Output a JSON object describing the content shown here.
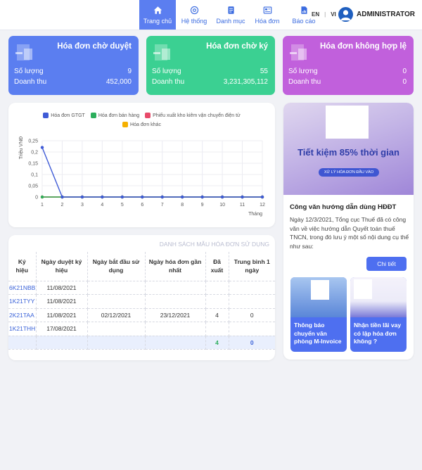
{
  "header": {
    "nav": [
      {
        "label": "Trang chủ",
        "icon": "home-icon",
        "active": true
      },
      {
        "label": "Hệ thống",
        "icon": "settings-icon"
      },
      {
        "label": "Danh mục",
        "icon": "list-icon"
      },
      {
        "label": "Hóa đơn",
        "icon": "invoice-icon"
      },
      {
        "label": "Báo cáo",
        "icon": "report-icon"
      }
    ],
    "lang_en": "EN",
    "lang_sep": "|",
    "lang_vi": "VI",
    "user": "ADMINISTRATOR"
  },
  "stats": [
    {
      "title": "Hóa đơn chờ duyệt",
      "count_label": "Số lượng",
      "count": "9",
      "revenue_label": "Doanh thu",
      "revenue": "452,000",
      "color": "#5b7ef0"
    },
    {
      "title": "Hóa đơn chờ ký",
      "count_label": "Số lượng",
      "count": "55",
      "revenue_label": "Doanh thu",
      "revenue": "3,231,305,112",
      "color": "#3bd092"
    },
    {
      "title": "Hóa đơn không hợp lệ",
      "count_label": "Số lượng",
      "count": "0",
      "revenue_label": "Doanh thu",
      "revenue": "0",
      "color": "#c160dc"
    }
  ],
  "chart_data": {
    "type": "line",
    "x": [
      1,
      2,
      3,
      4,
      5,
      6,
      7,
      8,
      9,
      10,
      11,
      12
    ],
    "xlabel": "Tháng",
    "ylabel": "Triệu VNĐ",
    "ylim": [
      0,
      0.25
    ],
    "yticks": [
      "0",
      "0,05",
      "0,1",
      "0,15",
      "0,2",
      "0,25"
    ],
    "grid": true,
    "legend_position": "top",
    "series": [
      {
        "name": "Hóa đơn GTGT",
        "color": "#3f5bd6",
        "values": [
          0.22,
          0,
          0,
          0,
          0,
          0,
          0,
          0,
          0,
          0,
          0,
          0
        ]
      },
      {
        "name": "Hóa đơn bán hàng",
        "color": "#2cae5c",
        "values": [
          0,
          0,
          0,
          0,
          0,
          0,
          0,
          0,
          0,
          0,
          0,
          0
        ]
      },
      {
        "name": "Phiếu xuất kho kiêm vận chuyển điện tử",
        "color": "#e84a6a",
        "values": [
          0,
          0,
          0,
          0,
          0,
          0,
          0,
          0,
          0,
          0,
          0,
          0
        ]
      },
      {
        "name": "Hóa đơn khác",
        "color": "#f5b000",
        "values": [
          0,
          0,
          0,
          0,
          0,
          0,
          0,
          0,
          0,
          0,
          0,
          0
        ]
      }
    ]
  },
  "table": {
    "title": "DANH SÁCH MẪU HÓA ĐƠN SỬ DỤNG",
    "headers": [
      "Ký hiệu",
      "Ngày duyệt ký hiệu",
      "Ngày bắt đầu sử dụng",
      "Ngày hóa đơn gần nhất",
      "Đã xuất",
      "Trung bình 1 ngày"
    ],
    "rows": [
      [
        "6K21NBB",
        "11/08/2021",
        "",
        "",
        "",
        ""
      ],
      [
        "1K21TYY",
        "11/08/2021",
        "",
        "",
        "",
        ""
      ],
      [
        "2K21TAA",
        "11/08/2021",
        "02/12/2021",
        "23/12/2021",
        "4",
        "0"
      ],
      [
        "1K21THH",
        "17/08/2021",
        "",
        "",
        "",
        ""
      ]
    ],
    "total": {
      "issued": "4",
      "avg": "0"
    }
  },
  "news": {
    "banner_title": "Tiết kiệm 85% thời gian",
    "banner_sub": "XỬ LÝ HÓA ĐƠN ĐẦU VÀO",
    "title": "Công văn hướng dẫn dùng HĐĐT",
    "body": "Ngày 12/3/2021, Tổng cục Thuế đã có công văn về việc hướng dẫn Quyết toán thuế TNCN, trong đó lưu ý một số nội dung cụ thể như sau:",
    "button": "Chi tiết",
    "cards": [
      {
        "caption": "Thông báo chuyển văn phòng M-Invoice"
      },
      {
        "caption": "Nhận tiền lãi vay có lập hóa đơn không ?"
      }
    ]
  }
}
